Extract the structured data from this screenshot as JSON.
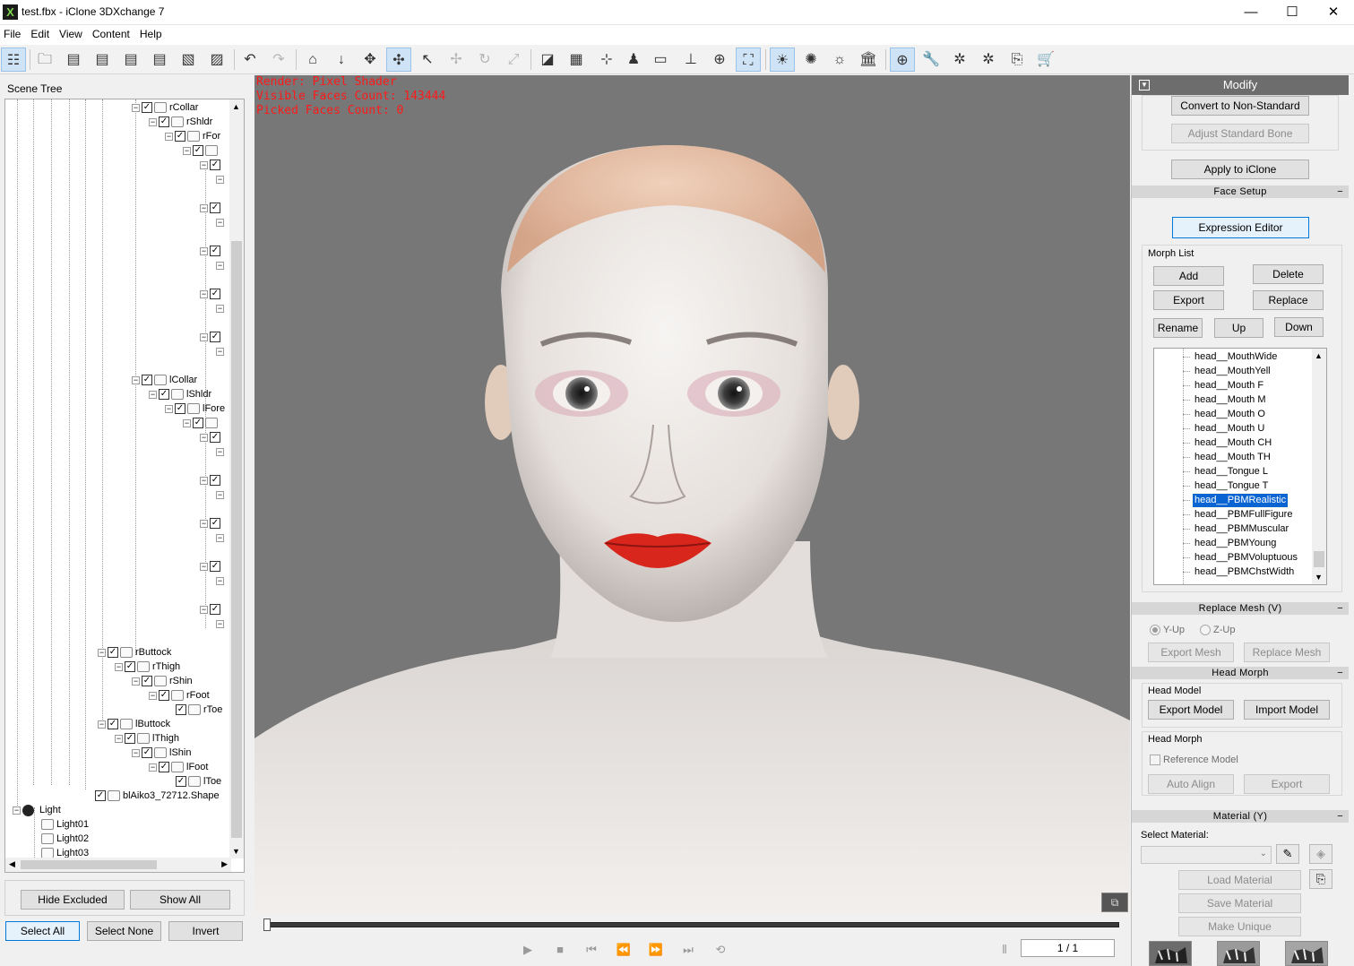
{
  "window": {
    "title": "test.fbx - iClone 3DXchange 7",
    "minimize": "—",
    "maximize": "☐",
    "close": "✕"
  },
  "menu": [
    "File",
    "Edit",
    "View",
    "Content",
    "Help"
  ],
  "scene_tree": {
    "label": "Scene Tree",
    "nodes": [
      {
        "label": "rCollar"
      },
      {
        "label": "rShldr"
      },
      {
        "label": "rFor"
      },
      {
        "label": "lCollar"
      },
      {
        "label": "lShldr"
      },
      {
        "label": "lFore"
      },
      {
        "label": "rButtock"
      },
      {
        "label": "rThigh"
      },
      {
        "label": "rShin"
      },
      {
        "label": "rFoot"
      },
      {
        "label": "rToe"
      },
      {
        "label": "lButtock"
      },
      {
        "label": "lThigh"
      },
      {
        "label": "lShin"
      },
      {
        "label": "lFoot"
      },
      {
        "label": "lToe"
      },
      {
        "label": "blAiko3_72712.Shape"
      },
      {
        "label": "Light"
      },
      {
        "label": "Light01"
      },
      {
        "label": "Light02"
      },
      {
        "label": "Light03"
      }
    ],
    "hide_excluded": "Hide Excluded",
    "show_all": "Show All",
    "select_all": "Select All",
    "select_none": "Select None",
    "invert": "Invert"
  },
  "viewport": {
    "render_line": "Render: Pixel Shader",
    "visible_faces_line": "Visible Faces Count: 143444",
    "picked_faces_line": "Picked Faces Count: 0"
  },
  "timeline": {
    "frame": "1 / 1"
  },
  "modify": {
    "title": "Modify",
    "convert_button": "Convert to Non-Standard",
    "adjust_bone_button": "Adjust Standard Bone",
    "apply_iclone_button": "Apply to iClone",
    "face_setup_header": "Face Setup",
    "expression_editor_button": "Expression Editor",
    "morph_list_label": "Morph List",
    "add": "Add",
    "delete": "Delete",
    "export": "Export",
    "replace": "Replace",
    "rename": "Rename",
    "up": "Up",
    "down": "Down",
    "morph_items": [
      "head__MouthWide",
      "head__MouthYell",
      "head__Mouth F",
      "head__Mouth M",
      "head__Mouth O",
      "head__Mouth U",
      "head__Mouth CH",
      "head__Mouth TH",
      "head__Tongue L",
      "head__Tongue T",
      "head__PBMRealistic",
      "head__PBMFullFigure",
      "head__PBMMuscular",
      "head__PBMYoung",
      "head__PBMVoluptuous",
      "head__PBMChstWidth"
    ],
    "selected_morph": "head__PBMRealistic",
    "replace_mesh_header": "Replace Mesh (V)",
    "y_up": "Y-Up",
    "z_up": "Z-Up",
    "export_mesh": "Export Mesh",
    "replace_mesh": "Replace Mesh",
    "head_morph_header": "Head Morph",
    "head_model_label": "Head Model",
    "export_model": "Export Model",
    "import_model": "Import Model",
    "head_morph_label": "Head Morph",
    "reference_model": "Reference Model",
    "auto_align": "Auto Align",
    "export2": "Export",
    "material_header": "Material (Y)",
    "select_material_label": "Select Material:",
    "load_material": "Load Material",
    "save_material": "Save Material",
    "make_unique": "Make Unique"
  }
}
